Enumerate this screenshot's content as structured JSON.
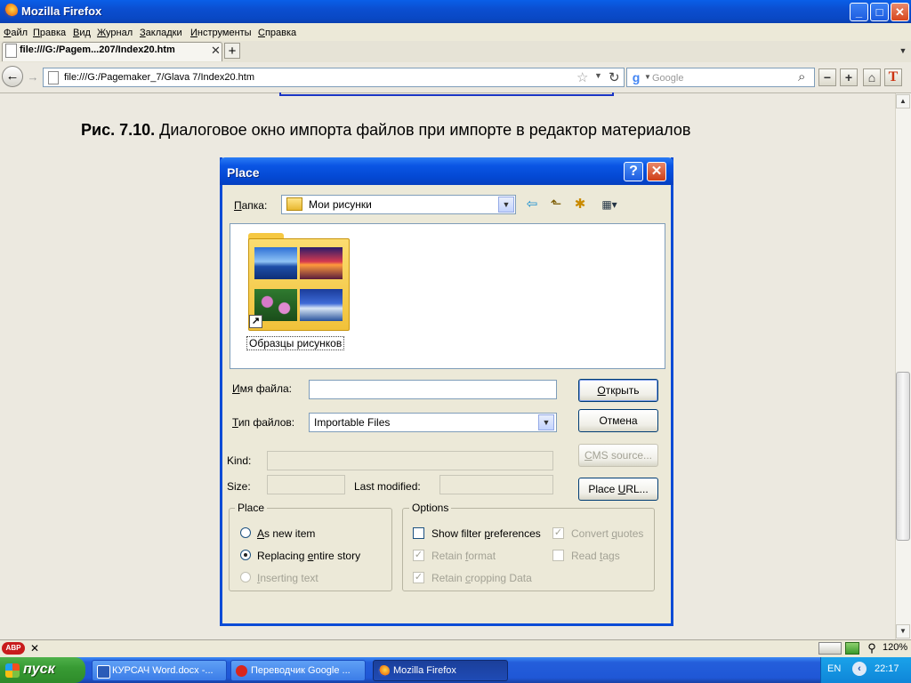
{
  "window": {
    "title": "Mozilla Firefox",
    "controls": {
      "minimize": "_",
      "maximize": "□",
      "close": "✕"
    }
  },
  "menu": [
    {
      "underline": "Ф",
      "rest": "айл"
    },
    {
      "underline": "П",
      "rest": "равка"
    },
    {
      "underline": "В",
      "rest": "ид"
    },
    {
      "underline": "Ж",
      "rest": "урнал"
    },
    {
      "underline": "З",
      "rest": "акладки"
    },
    {
      "underline": "И",
      "rest": "нструменты"
    },
    {
      "underline": "С",
      "rest": "правка"
    }
  ],
  "tabs": [
    {
      "label": "file:///G:/Pagem...207/Index20.htm",
      "close": "✕"
    }
  ],
  "new_tab_label": "+",
  "tab_scroll_label": "▼",
  "nav": {
    "back": "←",
    "forward": "→",
    "url": "file:///G:/Pagemaker_7/Glava 7/Index20.htm",
    "star": "☆",
    "url_dropdown": "▼",
    "reload": "↻",
    "search_engine_logo": "g",
    "search_dropdown": "▼",
    "search_placeholder": "Google",
    "search_icon": "⌕",
    "toolbar_buttons": [
      "−",
      "+",
      "⌂",
      "T"
    ]
  },
  "page": {
    "caption_bold": "Рис. 7.10.",
    "caption_text": " Диалоговое окно импорта файлов при импорте в редактор материалов"
  },
  "dialog": {
    "title": "Place",
    "help_label": "?",
    "close_label": "✕",
    "folder_label_u": "П",
    "folder_label_rest": "апка:",
    "folder_value": "Мои рисунки",
    "folder_dropdown": "▼",
    "tools": [
      "⇦",
      "⬑",
      "✱",
      "▦▾"
    ],
    "items": [
      {
        "name": "Образцы рисунков",
        "shortcut": "↗"
      }
    ],
    "filename_label_u": "И",
    "filename_label_rest": "мя файла:",
    "filename_value": "",
    "filetype_label_u": "Т",
    "filetype_label_rest": "ип файлов:",
    "filetype_value": "Importable Files",
    "filetype_dropdown": "▼",
    "kind_label": "Kind:",
    "size_label": "Size:",
    "last_modified_label": "Last modified:",
    "buttons": {
      "open_u": "О",
      "open_rest": "ткрыть",
      "cancel": "Отмена",
      "cms_u": "C",
      "cms_rest": "MS source...",
      "place_url_pre": "Place ",
      "place_url_u": "U",
      "place_url_rest": "RL..."
    },
    "place_group": {
      "title": "Place",
      "options": [
        {
          "pre": "",
          "u": "A",
          "rest": "s new item",
          "selected": false,
          "enabled": true
        },
        {
          "pre": "Replacing ",
          "u": "e",
          "rest": "ntire story",
          "selected": true,
          "enabled": true
        },
        {
          "pre": "",
          "u": "I",
          "rest": "nserting text",
          "selected": false,
          "enabled": false
        }
      ]
    },
    "options_group": {
      "title": "Options",
      "checks": [
        {
          "pre": "Show filter ",
          "u": "p",
          "rest": "references",
          "checked": false,
          "enabled": true
        },
        {
          "pre": "Convert ",
          "u": "q",
          "rest": "uotes",
          "checked": true,
          "enabled": false
        },
        {
          "pre": "Retain ",
          "u": "f",
          "rest": "ormat",
          "checked": true,
          "enabled": false
        },
        {
          "pre": "Read ",
          "u": "t",
          "rest": "ags",
          "checked": false,
          "enabled": false
        },
        {
          "pre": "Retain ",
          "u": "c",
          "rest": "ropping Data",
          "checked": true,
          "enabled": false
        }
      ]
    }
  },
  "statusbar": {
    "abp_label": "ABP",
    "close_label": "✕",
    "zoom": "120%"
  },
  "taskbar": {
    "start_label": "пуск",
    "tasks": [
      {
        "label": "КУРСАЧ Word.docx -...",
        "active": false
      },
      {
        "label": "Переводчик Google ...",
        "active": false
      },
      {
        "label": "Mozilla Firefox",
        "active": true
      }
    ],
    "lang": "EN",
    "tray_icon": "‹",
    "clock": "22:17"
  },
  "colors": {
    "xp_blue": "#0a55e4",
    "dialog_bg": "#ece9d8",
    "start_green": "#389b34"
  }
}
